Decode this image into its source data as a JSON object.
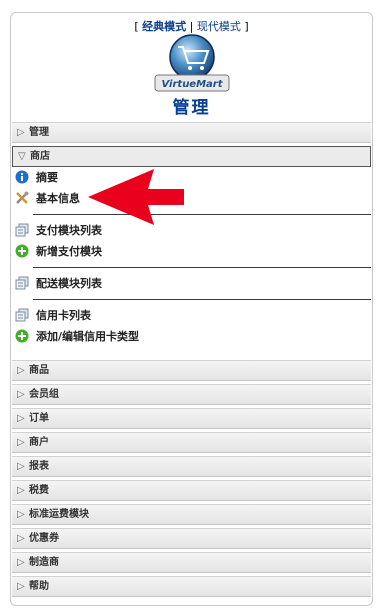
{
  "header": {
    "classic_mode": "经典模式",
    "modern_mode": "现代模式",
    "bracket_open": "[",
    "divider": "|",
    "bracket_close": "]",
    "logo_text": "VirtueMart",
    "admin_title": "管理"
  },
  "sections": [
    {
      "label": "管理",
      "expanded": false
    },
    {
      "label": "商店",
      "expanded": true
    },
    {
      "label": "商品",
      "expanded": false
    },
    {
      "label": "会员组",
      "expanded": false
    },
    {
      "label": "订单",
      "expanded": false
    },
    {
      "label": "商户",
      "expanded": false
    },
    {
      "label": "报表",
      "expanded": false
    },
    {
      "label": "税费",
      "expanded": false
    },
    {
      "label": "标准运费模块",
      "expanded": false
    },
    {
      "label": "优惠券",
      "expanded": false
    },
    {
      "label": "制造商",
      "expanded": false
    },
    {
      "label": "帮助",
      "expanded": false
    }
  ],
  "store_items": [
    {
      "label": "摘要",
      "icon": "info-icon"
    },
    {
      "label": "基本信息",
      "icon": "tools-icon"
    },
    {
      "label": "支付模块列表",
      "icon": "list-icon"
    },
    {
      "label": "新增支付模块",
      "icon": "add-icon"
    },
    {
      "label": "配送模块列表",
      "icon": "list-icon"
    },
    {
      "label": "信用卡列表",
      "icon": "list-icon"
    },
    {
      "label": "添加/编辑信用卡类型",
      "icon": "add-icon"
    }
  ],
  "annotation": {
    "arrow_color": "#e8001c",
    "arrow_target": "基本信息"
  }
}
